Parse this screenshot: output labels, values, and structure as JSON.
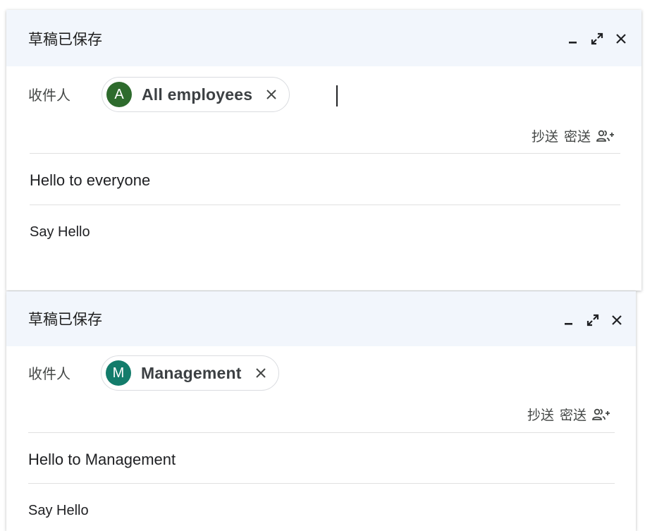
{
  "compose_windows": [
    {
      "title": "草稿已保存",
      "to_label": "收件人",
      "recipient": {
        "initial": "A",
        "name": "All employees",
        "avatar_color": "#2e6b2d"
      },
      "cc_label": "抄送",
      "bcc_label": "密送",
      "subject": "Hello to everyone",
      "body": "Say Hello"
    },
    {
      "title": "草稿已保存",
      "to_label": "收件人",
      "recipient": {
        "initial": "M",
        "name": "Management",
        "avatar_color": "#137c6b"
      },
      "cc_label": "抄送",
      "bcc_label": "密送",
      "subject": "Hello to Management",
      "body": "Say Hello"
    }
  ],
  "icons": {
    "minimize": "minimize-icon",
    "expand": "expand-icon",
    "close": "close-icon",
    "remove_recipient": "close-icon",
    "add_recipients": "person-add-icon"
  }
}
